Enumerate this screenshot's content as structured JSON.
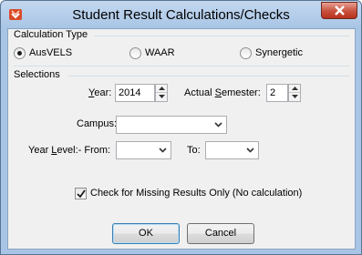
{
  "window": {
    "title": "Student Result Calculations/Checks",
    "colors": {
      "frame": "#a9c5e6",
      "client": "#f0f0f0",
      "close_button": "#c7503c"
    }
  },
  "calculation_type": {
    "heading": "Calculation Type",
    "options": [
      {
        "label": "AusVELS",
        "checked": true
      },
      {
        "label": "WAAR",
        "checked": false
      },
      {
        "label": "Synergetic",
        "checked": false
      }
    ]
  },
  "selections": {
    "heading": "Selections",
    "year": {
      "label_prefix": "Y",
      "label_rest": "ear:",
      "value": "2014"
    },
    "semester": {
      "label_prefix": "Actual ",
      "label_underlined": "S",
      "label_rest": "emester:",
      "value": "2"
    },
    "campus": {
      "label": "Campus:",
      "value": ""
    },
    "year_level": {
      "label_prefix": "Year ",
      "label_underlined": "L",
      "label_rest": "evel:-  From:",
      "from_value": "",
      "to_label": "To:",
      "to_value": ""
    },
    "check_missing": {
      "label": "Check for Missing Results Only (No calculation)",
      "checked": true
    }
  },
  "buttons": {
    "ok": "OK",
    "cancel": "Cancel"
  }
}
